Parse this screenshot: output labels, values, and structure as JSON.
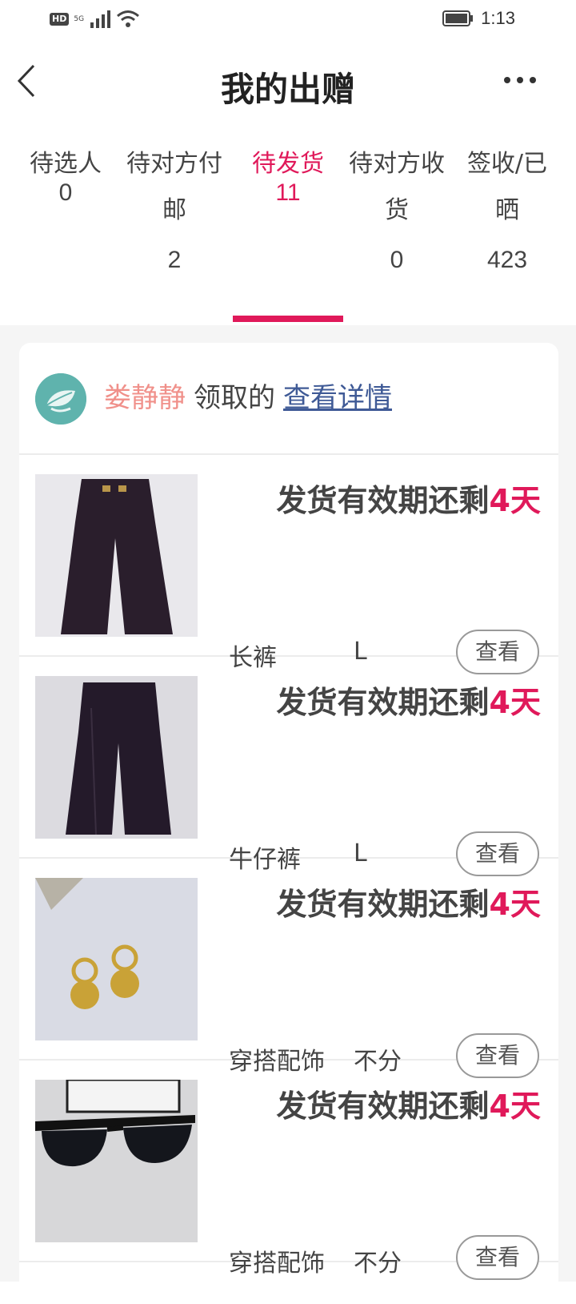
{
  "status_bar": {
    "hd_label": "HD",
    "network_label": "5G",
    "time": "1:13",
    "icons": [
      "signal-icon",
      "wifi-icon",
      "battery-icon"
    ]
  },
  "header": {
    "title": "我的出赠",
    "back_icon": "chevron-left-icon",
    "more_icon": "more-icon"
  },
  "tabs": [
    {
      "label_line1": "待选人",
      "label_line2": "",
      "count": "0",
      "active": false
    },
    {
      "label_line1": "待对方付",
      "label_line2": "邮",
      "count": "2",
      "active": false
    },
    {
      "label_line1": "待发货",
      "label_line2": "",
      "count": "11",
      "active": true
    },
    {
      "label_line1": "待对方收",
      "label_line2": "货",
      "count": "0",
      "active": false
    },
    {
      "label_line1": "签收/已",
      "label_line2": "晒",
      "count": "423",
      "active": false
    }
  ],
  "colors": {
    "accent": "#e0195a",
    "receiver": "#f0908a",
    "link": "#3f5a96"
  },
  "card": {
    "receiver_name": "娄静静",
    "received_text": "领取的",
    "detail_link": "查看详情",
    "items": [
      {
        "deadline_prefix": "发货有效期还剩",
        "deadline_days": "4天",
        "name": "长裤",
        "size": "L",
        "view_label": "查看",
        "image": "black-trousers"
      },
      {
        "deadline_prefix": "发货有效期还剩",
        "deadline_days": "4天",
        "name": "牛仔裤",
        "size": "L",
        "view_label": "查看",
        "image": "dark-jeans"
      },
      {
        "deadline_prefix": "发货有效期还剩",
        "deadline_days": "4天",
        "name": "穿搭配饰",
        "size": "不分",
        "view_label": "查看",
        "image": "gold-earrings"
      },
      {
        "deadline_prefix": "发货有效期还剩",
        "deadline_days": "4天",
        "name": "穿搭配饰",
        "size": "不分",
        "view_label": "查看",
        "image": "sunglasses"
      }
    ]
  }
}
